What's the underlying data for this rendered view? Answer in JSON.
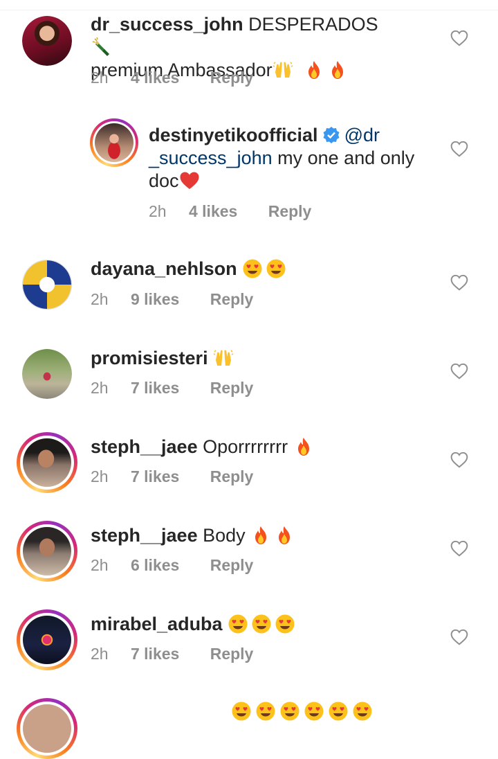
{
  "comments": [
    {
      "username": "dr_success_john",
      "text": "DESPERADOS",
      "text2": "premium Ambassador",
      "time": "2h",
      "likes": "4 likes",
      "reply": "Reply"
    },
    {
      "username": "destinyetikoofficial",
      "mention": "@dr_success_john",
      "mention_a": "@dr",
      "mention_b": "_success_john",
      "text": "my one and only",
      "text2": "doc",
      "time": "2h",
      "likes": "4 likes",
      "reply": "Reply"
    },
    {
      "username": "dayana_nehlson",
      "text": "",
      "time": "2h",
      "likes": "9 likes",
      "reply": "Reply"
    },
    {
      "username": "promisiesteri",
      "text": "",
      "time": "2h",
      "likes": "7 likes",
      "reply": "Reply"
    },
    {
      "username": "steph__jaee",
      "text": "Oporrrrrrrr",
      "time": "2h",
      "likes": "7 likes",
      "reply": "Reply"
    },
    {
      "username": "steph__jaee",
      "text": "Body",
      "time": "2h",
      "likes": "6 likes",
      "reply": "Reply"
    },
    {
      "username": "mirabel_aduba",
      "text": "",
      "time": "2h",
      "likes": "7 likes",
      "reply": "Reply"
    }
  ],
  "icons": {
    "heart": "heart-outline-icon",
    "verified": "verified-badge-icon",
    "fire": "fire-emoji",
    "raised_hands": "raised-hands-emoji",
    "heart_eyes": "heart-eyes-emoji",
    "champagne": "champagne-emoji",
    "red_heart": "red-heart-emoji"
  },
  "colors": {
    "text": "#262626",
    "meta": "#8e8e8e",
    "mention": "#00376b",
    "verified": "#3897f0",
    "heart_icon": "#8e8e8e"
  }
}
